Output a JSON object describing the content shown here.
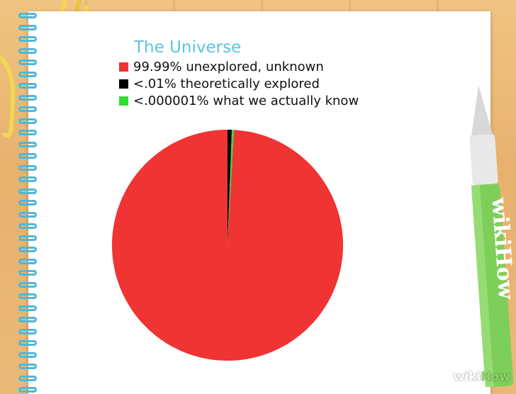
{
  "chart_data": {
    "type": "pie",
    "title": "The Universe",
    "slices": [
      {
        "label": "99.99% unexplored, unknown",
        "value": 99.99,
        "color": "#f03333"
      },
      {
        "label": "<.01% theoretically explored",
        "value": 0.6,
        "color": "#000000"
      },
      {
        "label": "<.000001% what we actually know",
        "value": 0.3,
        "color": "#33dd33"
      }
    ],
    "legend_position": "top-left"
  },
  "pen": {
    "logo_text": "wikiHow",
    "color": "#7ecf5a"
  },
  "watermark": {
    "text_a": "wiki",
    "text_b": "How"
  }
}
